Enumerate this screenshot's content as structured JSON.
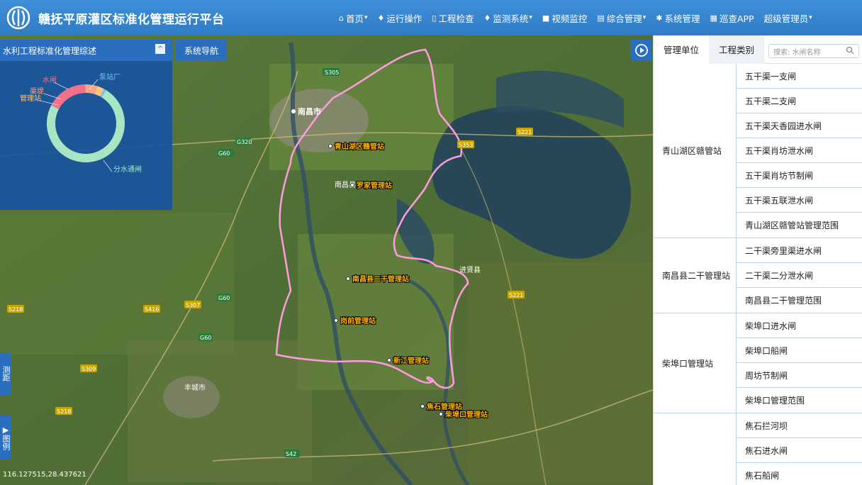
{
  "header": {
    "title": "赣抚平原灌区标准化管理运行平台",
    "nav": [
      {
        "icon": "home-icon",
        "label": "首页",
        "dropdown": true
      },
      {
        "icon": "drop-icon",
        "label": "运行操作",
        "dropdown": false
      },
      {
        "icon": "doc-icon",
        "label": "工程检查",
        "dropdown": false
      },
      {
        "icon": "drop-icon",
        "label": "监测系统",
        "dropdown": true
      },
      {
        "icon": "video-icon",
        "label": "视频监控",
        "dropdown": false
      },
      {
        "icon": "file-icon",
        "label": "综合管理",
        "dropdown": true
      },
      {
        "icon": "gear-icon",
        "label": "系统管理",
        "dropdown": false
      },
      {
        "icon": "app-icon",
        "label": "巡查APP",
        "dropdown": false
      },
      {
        "icon": "",
        "label": "超级管理员",
        "dropdown": true
      }
    ]
  },
  "left_panel": {
    "title": "水利工程标准化管理综述",
    "sys_nav": "系统导航",
    "chart_labels": [
      "水闸",
      "渠堤",
      "管理站",
      "泵站厂",
      "分水通闸"
    ]
  },
  "chart_data": {
    "type": "pie",
    "categories": [
      "分水通闸",
      "水闸",
      "渠堤",
      "管理站",
      "泵站厂"
    ],
    "values": [
      74,
      17,
      5,
      3,
      1
    ],
    "colors": [
      "#a8e6c3",
      "#f3708a",
      "#f6a48a",
      "#ffc57a",
      "#6fc9f0"
    ]
  },
  "map": {
    "coords": "116.127515,28.437621",
    "side_tabs": [
      "测距",
      "图例"
    ],
    "stations": [
      "青山湖区赣管站",
      "罗家管理站",
      "南昌县二干管理站",
      "岗前管理站",
      "新江管理站",
      "焦石管理站",
      "柴埠口管理站"
    ],
    "places": [
      "南昌市",
      "南昌县",
      "丰城市",
      "进贤县",
      "G60",
      "G320",
      "S42",
      "S215",
      "S307",
      "S309",
      "S218",
      "S221",
      "S353",
      "S416"
    ]
  },
  "right_panel": {
    "tabs": [
      "管理单位",
      "工程类别"
    ],
    "search_placeholder": "搜索: 水闸名称",
    "groups": [
      {
        "name": "青山湖区赣管站",
        "items": [
          "五干渠一支闸",
          "五干渠二支闸",
          "五干渠天香园进水闸",
          "五干渠肖坊泄水闸",
          "五干渠肖坊节制闸",
          "五干渠五联泄水闸",
          "青山湖区赣管站管理范围"
        ]
      },
      {
        "name": "南昌县二干管理站",
        "items": [
          "二干渠旁里渠进水闸",
          "二干渠二分泄水闸",
          "南昌县二干管理范围"
        ]
      },
      {
        "name": "柴埠口管理站",
        "items": [
          "柴埠口进水闸",
          "柴埠口船闸",
          "周坊节制闸",
          "柴埠口管理范围"
        ]
      },
      {
        "name": "",
        "items": [
          "焦石拦河坝",
          "焦石进水闸",
          "焦石船闸"
        ]
      }
    ]
  }
}
